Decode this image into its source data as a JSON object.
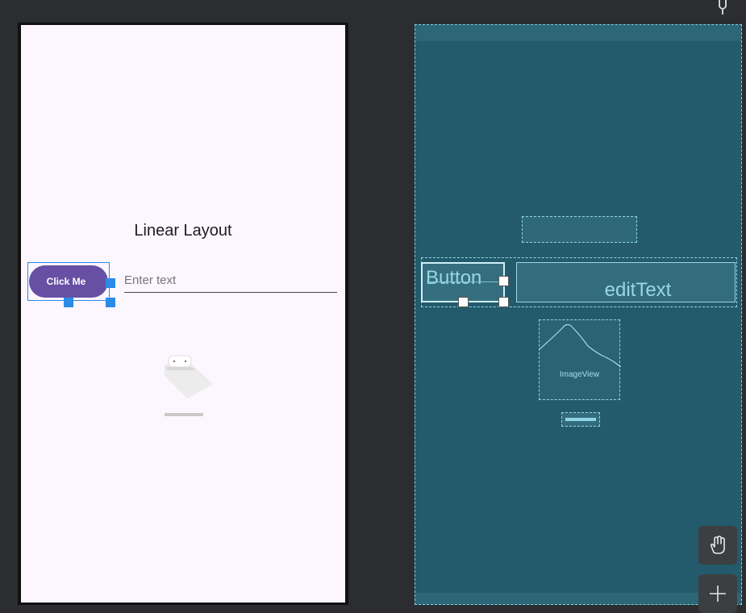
{
  "design": {
    "title": "Linear Layout",
    "button_label": "Click Me",
    "edit_placeholder": "Enter text"
  },
  "blueprint": {
    "button_label": "Button",
    "edit_label": "editText",
    "image_label": "ImageView"
  },
  "tools": {
    "pan_icon": "hand-icon",
    "zoom_icon": "plus-icon"
  },
  "colors": {
    "canvas_bg": "#2b2d30",
    "design_bg": "#fcf6ff",
    "button_bg": "#6750a4",
    "selection": "#2b8be6",
    "blueprint_bg": "#235b6c",
    "blueprint_line": "#8fd5e6"
  }
}
